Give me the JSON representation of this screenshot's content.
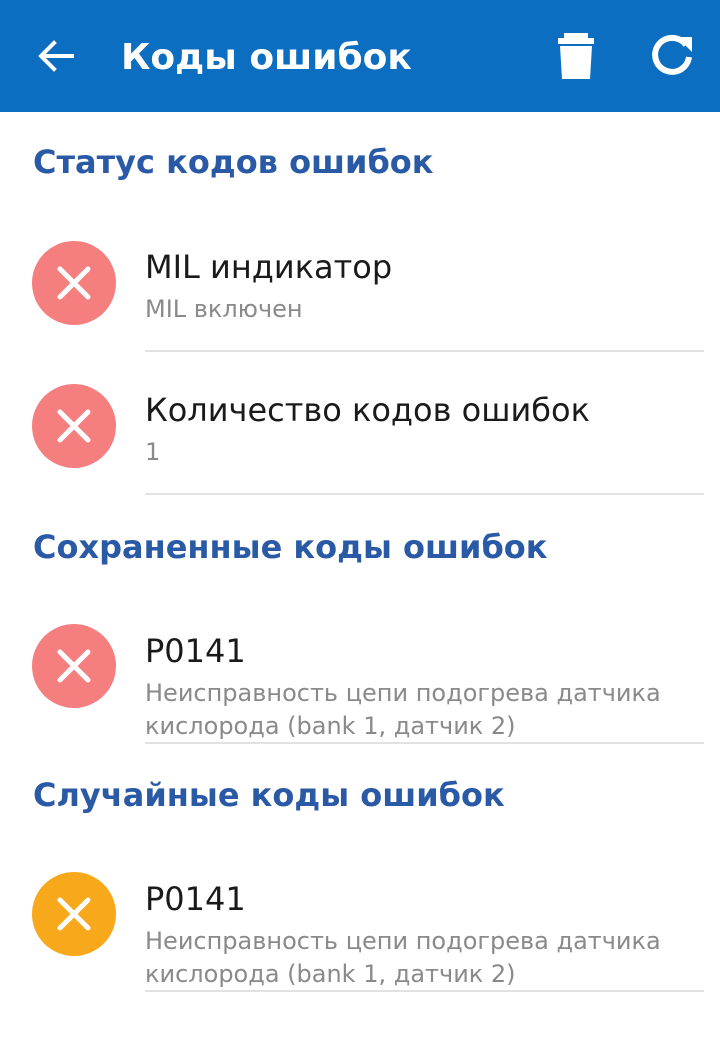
{
  "appbar": {
    "title": "Коды ошибок",
    "background": "#0b6ec1",
    "back_icon": "arrow-left-icon",
    "delete_icon": "trash-icon",
    "refresh_icon": "refresh-icon"
  },
  "sections": {
    "status": {
      "title": "Статус кодов ошибок",
      "items": [
        {
          "primary": "MIL индикатор",
          "secondary": "MIL включен",
          "state": "error"
        },
        {
          "primary": "Количество кодов ошибок",
          "secondary": "1",
          "state": "error"
        }
      ]
    },
    "stored": {
      "title": "Сохраненные коды ошибок",
      "items": [
        {
          "primary": "P0141",
          "secondary": "Неисправность цепи подогрева датчика кислорода (bank 1, датчик 2)",
          "state": "error"
        }
      ]
    },
    "pending": {
      "title": "Случайные коды ошибок",
      "items": [
        {
          "primary": "P0141",
          "secondary": "Неисправность цепи подогрева датчика кислорода (bank 1, датчик 2)",
          "state": "warning"
        }
      ]
    }
  },
  "colors": {
    "section_title": "#2a5aa5",
    "error": "#f57f7f",
    "warning": "#f7a81b"
  }
}
